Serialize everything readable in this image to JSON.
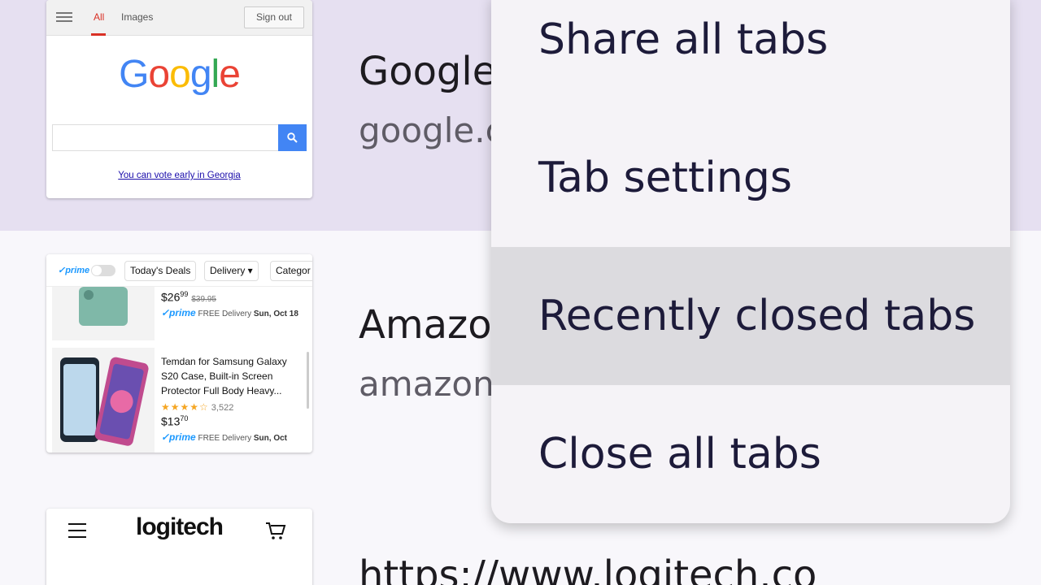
{
  "tabs": [
    {
      "title": "Google",
      "url": "google.com",
      "thumbnail": {
        "tab_all": "All",
        "tab_images": "Images",
        "sign_out": "Sign out",
        "logo": "Google",
        "vote_link": "You can vote early in Georgia"
      }
    },
    {
      "title": "Amazon",
      "url": "amazon",
      "thumbnail": {
        "prime_label": "✓prime",
        "chip_deals": "Today's Deals",
        "chip_delivery": "Delivery ▾",
        "chip_category": "Categor",
        "item1_price_whole": "$26",
        "item1_price_cents": "99",
        "item1_old_price": "$39.95",
        "item1_prime": "✓prime",
        "item1_delivery": "FREE Delivery",
        "item1_date": "Sun, Oct 18",
        "item2_title": "Temdan for Samsung Galaxy S20 Case, Built-in Screen Protector Full Body Heavy...",
        "item2_stars": "★★★★☆",
        "item2_reviews": "3,522",
        "item2_price_whole": "$13",
        "item2_price_cents": "70",
        "item2_prime": "✓prime",
        "item2_delivery": "FREE Delivery",
        "item2_date": "Sun, Oct"
      }
    },
    {
      "title": "https://www.logitech.co",
      "thumbnail": {
        "logo": "logitech"
      }
    }
  ],
  "menu": {
    "items": [
      {
        "label": "Share all tabs"
      },
      {
        "label": "Tab settings"
      },
      {
        "label": "Recently closed tabs"
      },
      {
        "label": "Close all tabs"
      }
    ],
    "highlighted_index": 2
  },
  "colors": {
    "active_row_bg": "#e6e0f1",
    "menu_bg": "#f5f3f7",
    "menu_highlight": "#dcdbdf",
    "google_blue": "#4285f4"
  }
}
